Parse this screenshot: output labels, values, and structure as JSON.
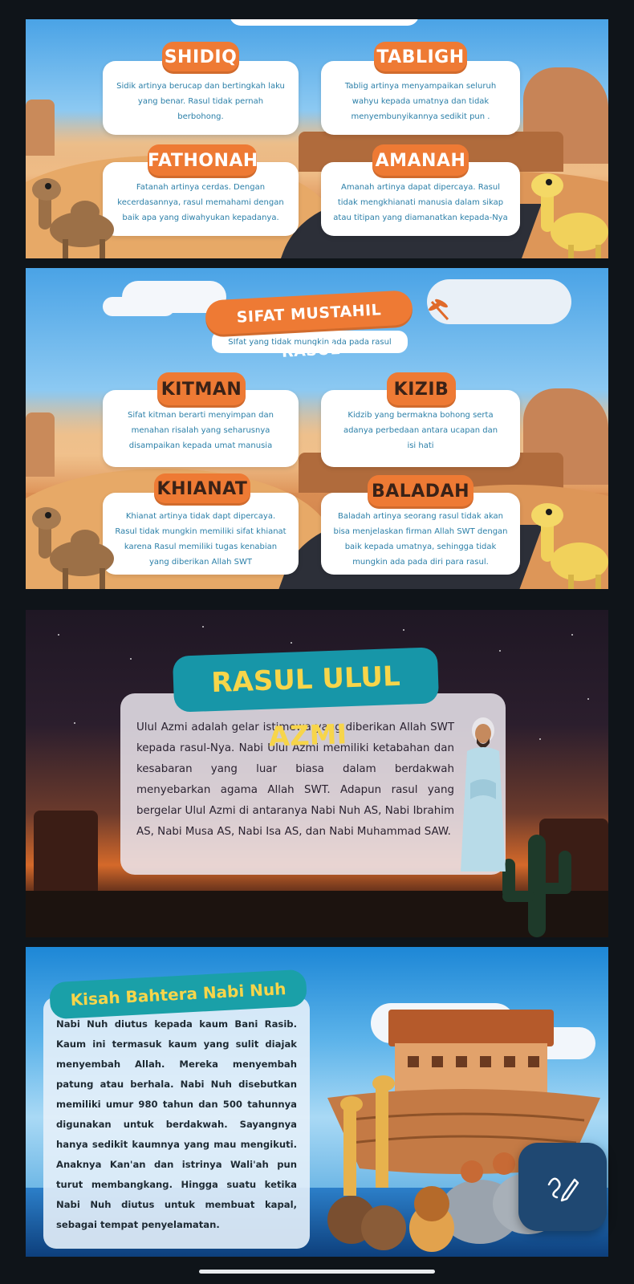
{
  "slide1": {
    "cards": [
      {
        "title": "SHIDIQ",
        "text": "Sidik artinya berucap dan bertingkah laku yang benar. Rasul tidak pernah berbohong."
      },
      {
        "title": "TABLIGH",
        "text": "Tablig artinya menyampaikan seluruh wahyu kepada umatnya dan tidak menyembunyikannya sedikit pun ."
      },
      {
        "title": "FATHONAH",
        "text": "Fatanah artinya cerdas. Dengan kecerdasannya, rasul memahami dengan baik apa yang diwahyukan kepadanya."
      },
      {
        "title": "AMANAH",
        "text": "Amanah artinya dapat dipercaya. Rasul tidak mengkhianati manusia dalam sikap atau titipan yang diamanatkan kepada-Nya"
      }
    ]
  },
  "slide2": {
    "heading": "SIFAT MUSTAHIL RASUL",
    "subheading": "SIfat yang tidak mungkin ada pada rasul",
    "cards": [
      {
        "title": "KITMAN",
        "text": "Sifat kitman berarti menyimpan dan menahan risalah yang seharusnya disampaikan kepada umat manusia"
      },
      {
        "title": "KIZIB",
        "text": "Kidzib yang bermakna bohong serta adanya perbedaan antara ucapan dan isi hati"
      },
      {
        "title": "KHIANAT",
        "text": "Khianat artinya tidak dapt dipercaya. Rasul tidak mungkin memiliki sifat khianat karena Rasul memiliki tugas kenabian yang diberikan Allah SWT"
      },
      {
        "title": "BALADAH",
        "text": "Baladah artinya seorang rasul tidak akan bisa menjelaskan firman Allah SWT dengan baik kepada umatnya, sehingga tidak mungkin ada pada diri para rasul."
      }
    ]
  },
  "slide3": {
    "title": "RASUL ULUL AZMI",
    "body": "Ulul Azmi adalah gelar istimewa yang diberikan Allah SWT kepada rasul-Nya. Nabi Ulul Azmi memiliki ketabahan dan kesabaran yang luar biasa dalam berdakwah menyebarkan agama Allah SWT. Adapun rasul yang bergelar Ulul Azmi di antaranya Nabi Nuh AS, Nabi Ibrahim AS, Nabi Musa AS, Nabi Isa AS, dan Nabi Muhammad SAW."
  },
  "slide4": {
    "title": "Kisah Bahtera Nabi Nuh",
    "body": "Nabi Nuh diutus kepada kaum Bani Rasib. Kaum ini termasuk kaum yang sulit diajak menyembah Allah. Mereka menyembah patung atau berhala. Nabi Nuh disebutkan memiliki umur 980 tahun dan 500 tahunnya digunakan untuk berdakwah. Sayangnya hanya sedikit kaumnya yang mau mengikuti. Anaknya Kan'an dan istrinya Wali'ah pun turut membangkang. Hingga suatu ketika Nabi Nuh diutus untuk membuat kapal, sebagai tempat penyelamatan."
  },
  "colors": {
    "accent_orange": "#ee7a34",
    "card_text": "#2b7fa8",
    "ribbon_teal": "#1796a8",
    "ribbon_text": "#f7d54a",
    "fab": "#1f4872"
  },
  "icons": {
    "fab": "pencil-signature-icon"
  }
}
